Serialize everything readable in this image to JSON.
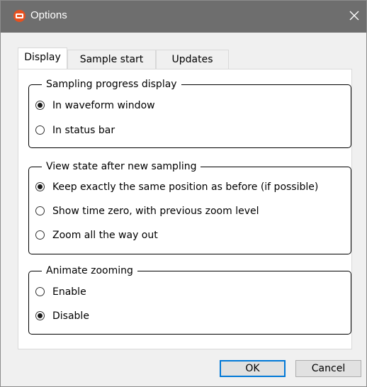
{
  "window": {
    "title": "Options"
  },
  "tabs": [
    {
      "label": "Display",
      "selected": true
    },
    {
      "label": "Sample start",
      "selected": false
    },
    {
      "label": "Updates",
      "selected": false
    }
  ],
  "groups": {
    "sampling": {
      "title": "Sampling progress display",
      "options": [
        {
          "label": "In waveform window",
          "checked": true
        },
        {
          "label": "In status bar",
          "checked": false
        }
      ]
    },
    "view_state": {
      "title": "View state after new sampling",
      "options": [
        {
          "label": "Keep exactly the same position as before (if possible)",
          "checked": true
        },
        {
          "label": "Show time zero, with previous zoom level",
          "checked": false
        },
        {
          "label": "Zoom all the way out",
          "checked": false
        }
      ]
    },
    "animate": {
      "title": "Animate zooming",
      "options": [
        {
          "label": "Enable",
          "checked": false
        },
        {
          "label": "Disable",
          "checked": true
        }
      ]
    }
  },
  "buttons": {
    "ok": "OK",
    "cancel": "Cancel"
  },
  "colors": {
    "titlebar": "#6e6e6e",
    "app_icon": "#e8501e",
    "accent": "#0078d7"
  }
}
